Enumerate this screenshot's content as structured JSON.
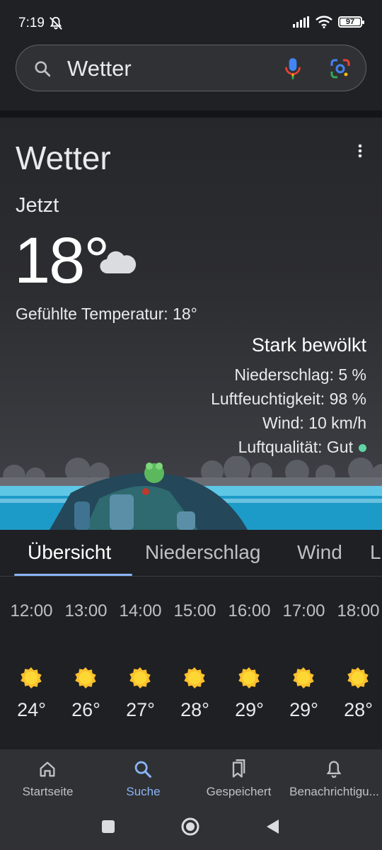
{
  "status": {
    "time": "7:19",
    "battery": "97"
  },
  "search": {
    "query": "Wetter"
  },
  "weather": {
    "title": "Wetter",
    "now_label": "Jetzt",
    "temperature": "18°",
    "feels_like": "Gefühlte Temperatur: 18°",
    "condition": "Stark bewölkt",
    "precipitation": "Niederschlag: 5 %",
    "humidity": "Luftfeuchtigkeit: 98 %",
    "wind": "Wind: 10 km/h",
    "air_quality": "Luftqualität: Gut",
    "air_quality_color": "#5fd5a4"
  },
  "tabs": [
    {
      "label": "Übersicht"
    },
    {
      "label": "Niederschlag"
    },
    {
      "label": "Wind"
    },
    {
      "label": "L"
    }
  ],
  "hourly": [
    {
      "time": "12:00",
      "temp": "24°",
      "icon": "sun-icon"
    },
    {
      "time": "13:00",
      "temp": "26°",
      "icon": "sun-icon"
    },
    {
      "time": "14:00",
      "temp": "27°",
      "icon": "sun-icon"
    },
    {
      "time": "15:00",
      "temp": "28°",
      "icon": "sun-icon"
    },
    {
      "time": "16:00",
      "temp": "29°",
      "icon": "sun-icon"
    },
    {
      "time": "17:00",
      "temp": "29°",
      "icon": "sun-icon"
    },
    {
      "time": "18:00",
      "temp": "28°",
      "icon": "sun-icon"
    }
  ],
  "bottom_nav": [
    {
      "label": "Startseite",
      "icon": "home-icon"
    },
    {
      "label": "Suche",
      "icon": "search-icon"
    },
    {
      "label": "Gespeichert",
      "icon": "bookmarks-icon"
    },
    {
      "label": "Benachrichtigu...",
      "icon": "bell-icon"
    }
  ],
  "colors": {
    "accent": "#8ab4f8",
    "background": "#1f2023",
    "sun": "#fbc02d"
  }
}
